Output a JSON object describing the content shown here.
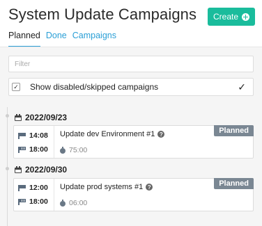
{
  "page": {
    "title": "System Update Campaigns"
  },
  "toolbar": {
    "create_label": "Create"
  },
  "tabs": [
    {
      "label": "Planned",
      "active": true
    },
    {
      "label": "Done",
      "active": false
    },
    {
      "label": "Campaigns",
      "active": false
    }
  ],
  "filter": {
    "placeholder": "Filter",
    "value": ""
  },
  "toggle": {
    "label": "Show disabled/skipped campaigns",
    "checked": true
  },
  "groups": [
    {
      "date": "2022/09/23",
      "items": [
        {
          "title": "Update dev Environment #1",
          "start": "14:08",
          "end": "18:00",
          "duration": "75:00",
          "status": "Planned"
        }
      ]
    },
    {
      "date": "2022/09/30",
      "items": [
        {
          "title": "Update prod systems #1",
          "start": "12:00",
          "end": "18:00",
          "duration": "06:00",
          "status": "Planned"
        }
      ]
    }
  ],
  "colors": {
    "accent": "#1abc9c",
    "link": "#2a9fd6",
    "badge": "#7a8793",
    "background": "#f5f5f5"
  },
  "icons": [
    "plus-circle-icon",
    "checkbox-icon",
    "checkmark-icon",
    "calendar-icon",
    "flag-icon",
    "checkered-flag-icon",
    "help-icon",
    "stopwatch-icon"
  ]
}
